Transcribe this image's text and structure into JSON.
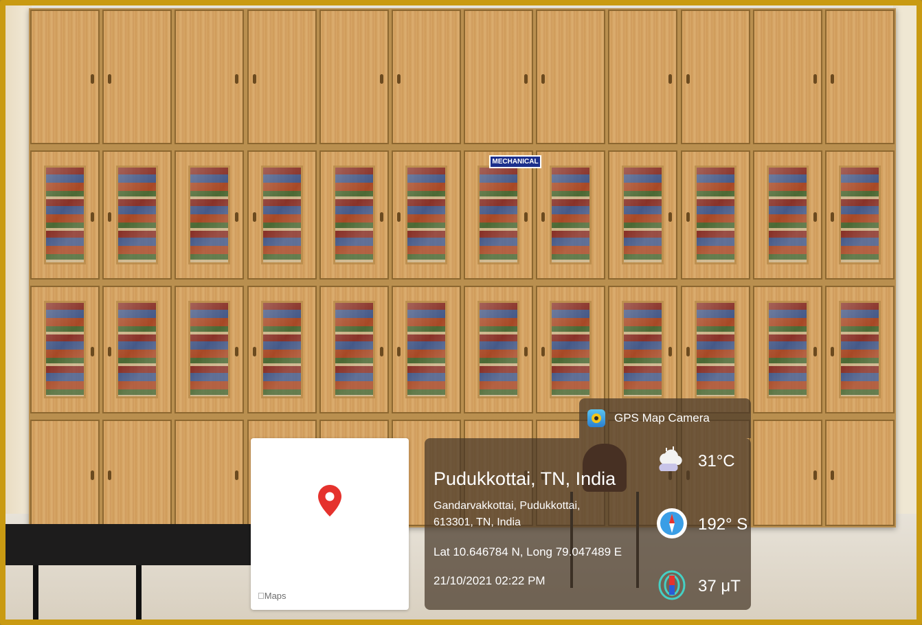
{
  "scene": {
    "cabinet_sign": "MECHANICAL"
  },
  "map": {
    "label": "Maps",
    "pin_color": "#e5322d"
  },
  "app": {
    "name": "GPS Map Camera",
    "icon": "gps-map-camera-app-icon"
  },
  "location": {
    "title": "Pudukkottai, TN, India",
    "address_line1": "Gandarvakkottai, Pudukkottai,",
    "address_line2": "613301, TN, India",
    "lat_long": "Lat 10.646784 N, Long 79.047489 E",
    "datetime": "21/10/2021 02:22 PM"
  },
  "stats": {
    "temperature": "31°C",
    "compass": "192° S",
    "magnetic_field": "37 μT"
  },
  "colors": {
    "frame": "#c99a12",
    "overlay": "rgba(70,55,40,0.72)"
  }
}
